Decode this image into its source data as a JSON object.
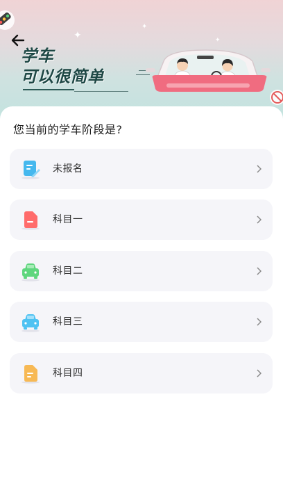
{
  "header": {
    "slogan_line1": "学车",
    "slogan_line2": "可以很简单"
  },
  "question": "您当前的学车阶段是?",
  "options": [
    {
      "label": "未报名",
      "icon": "document-edit-icon",
      "color": "#45b8ee"
    },
    {
      "label": "科目一",
      "icon": "exam-paper-icon",
      "color": "#ff6b6b"
    },
    {
      "label": "科目二",
      "icon": "car-icon",
      "color": "#5fd67e"
    },
    {
      "label": "科目三",
      "icon": "car-icon",
      "color": "#4ec2f2"
    },
    {
      "label": "科目四",
      "icon": "exam-paper-icon",
      "color": "#f7b955"
    }
  ]
}
